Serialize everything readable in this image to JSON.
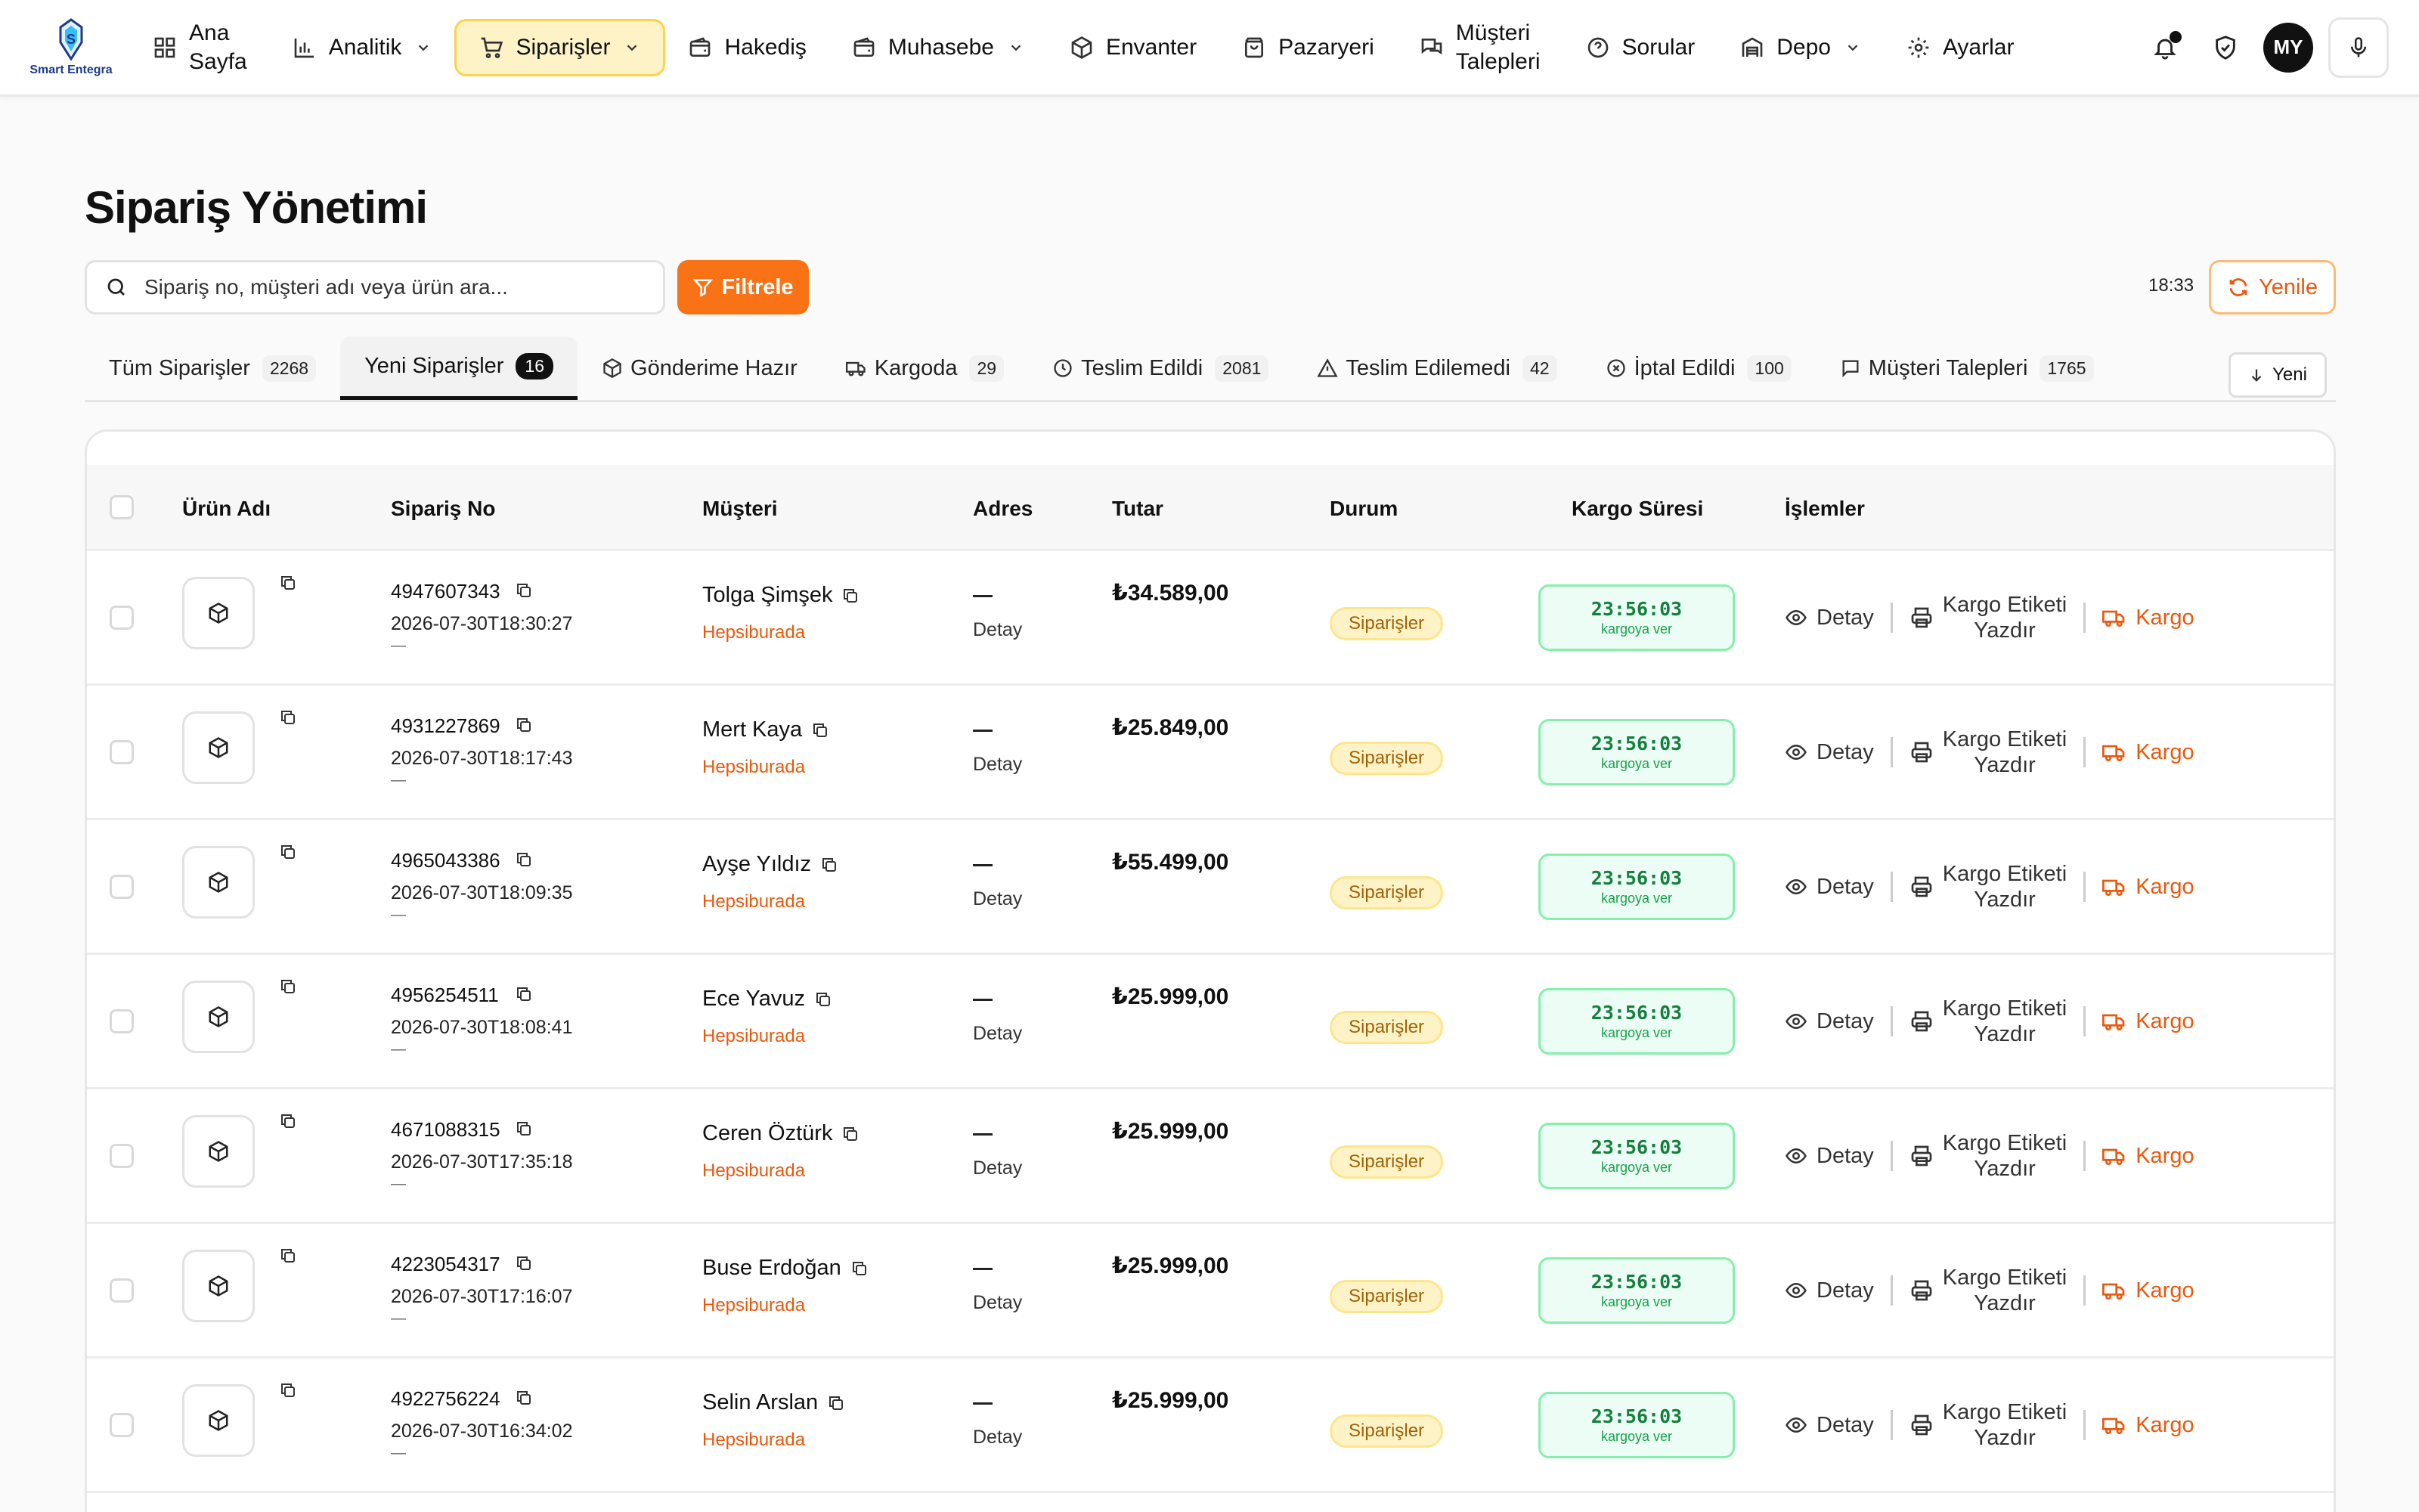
{
  "brand": {
    "logo_text": "Smart Entegra"
  },
  "nav": {
    "items": [
      {
        "label": "Ana Sayfa",
        "line1": "Ana",
        "line2": "Sayfa",
        "icon": "dashboard-icon"
      },
      {
        "label": "Analitik",
        "icon": "chart-icon",
        "dropdown": true
      },
      {
        "label": "Siparişler",
        "icon": "cart-icon",
        "dropdown": true,
        "active": true
      },
      {
        "label": "Hakediş",
        "icon": "wallet-icon"
      },
      {
        "label": "Muhasebe",
        "icon": "wallet-icon",
        "dropdown": true
      },
      {
        "label": "Envanter",
        "icon": "box-icon"
      },
      {
        "label": "Pazaryeri",
        "icon": "bag-icon"
      },
      {
        "label": "Müşteri Talepleri",
        "line1": "Müşteri",
        "line2": "Talepleri",
        "icon": "chat-icon"
      },
      {
        "label": "Sorular",
        "icon": "question-icon"
      },
      {
        "label": "Depo",
        "icon": "warehouse-icon",
        "dropdown": true
      },
      {
        "label": "Ayarlar",
        "icon": "gear-icon"
      }
    ],
    "user_initials": "MY"
  },
  "page": {
    "title": "Sipariş Yönetimi"
  },
  "toolbar": {
    "search_placeholder": "Sipariş no, müşteri adı veya ürün ara...",
    "filter_label": "Filtrele",
    "time": "18:33",
    "refresh_label": "Yenile",
    "sort_label": "Yeni"
  },
  "tabs": [
    {
      "label": "Tüm Siparişler",
      "count": "2268"
    },
    {
      "label": "Yeni Siparişler",
      "count": "16",
      "active": true
    },
    {
      "label": "Gönderime Hazır",
      "count": "",
      "icon": "box-icon"
    },
    {
      "label": "Kargoda",
      "count": "29",
      "icon": "truck-icon"
    },
    {
      "label": "Teslim Edildi",
      "count": "2081",
      "icon": "clock-icon"
    },
    {
      "label": "Teslim Edilemedi",
      "count": "42",
      "icon": "warning-icon"
    },
    {
      "label": "İptal Edildi",
      "count": "100",
      "icon": "x-circle-icon"
    },
    {
      "label": "Müşteri Talepleri",
      "count": "1765",
      "icon": "message-icon"
    }
  ],
  "table": {
    "headers": {
      "product": "Ürün Adı",
      "order_no": "Sipariş No",
      "customer": "Müşteri",
      "address": "Adres",
      "amount": "Tutar",
      "status": "Durum",
      "cargo_time": "Kargo Süresi",
      "actions": "İşlemler"
    },
    "rows": [
      {
        "order_no": "4947607343",
        "date": "2026-07-30T18:30:27",
        "customer": "Tolga Şimşek",
        "store": "Hepsiburada",
        "address_detail": "Detay",
        "amount": "₺34.589,00",
        "status": "Siparişler",
        "cargo_time": "23:56:03",
        "cargo_sub": "kargoya ver"
      },
      {
        "order_no": "4931227869",
        "date": "2026-07-30T18:17:43",
        "customer": "Mert Kaya",
        "store": "Hepsiburada",
        "address_detail": "Detay",
        "amount": "₺25.849,00",
        "status": "Siparişler",
        "cargo_time": "23:56:03",
        "cargo_sub": "kargoya ver"
      },
      {
        "order_no": "4965043386",
        "date": "2026-07-30T18:09:35",
        "customer": "Ayşe Yıldız",
        "store": "Hepsiburada",
        "address_detail": "Detay",
        "amount": "₺55.499,00",
        "status": "Siparişler",
        "cargo_time": "23:56:03",
        "cargo_sub": "kargoya ver"
      },
      {
        "order_no": "4956254511",
        "date": "2026-07-30T18:08:41",
        "customer": "Ece Yavuz",
        "store": "Hepsiburada",
        "address_detail": "Detay",
        "amount": "₺25.999,00",
        "status": "Siparişler",
        "cargo_time": "23:56:03",
        "cargo_sub": "kargoya ver"
      },
      {
        "order_no": "4671088315",
        "date": "2026-07-30T17:35:18",
        "customer": "Ceren Öztürk",
        "store": "Hepsiburada",
        "address_detail": "Detay",
        "amount": "₺25.999,00",
        "status": "Siparişler",
        "cargo_time": "23:56:03",
        "cargo_sub": "kargoya ver"
      },
      {
        "order_no": "4223054317",
        "date": "2026-07-30T17:16:07",
        "customer": "Buse Erdoğan",
        "store": "Hepsiburada",
        "address_detail": "Detay",
        "amount": "₺25.999,00",
        "status": "Siparişler",
        "cargo_time": "23:56:03",
        "cargo_sub": "kargoya ver"
      },
      {
        "order_no": "4922756224",
        "date": "2026-07-30T16:34:02",
        "customer": "Selin Arslan",
        "store": "Hepsiburada",
        "address_detail": "Detay",
        "amount": "₺25.999,00",
        "status": "Siparişler",
        "cargo_time": "23:56:03",
        "cargo_sub": "kargoya ver"
      }
    ],
    "actions": {
      "detail": "Detay",
      "label_line1": "Kargo Etiketi",
      "label_line2": "Yazdır",
      "cargo": "Kargo"
    }
  },
  "colors": {
    "accent": "#f97316",
    "active_nav_bg": "#fef3c7",
    "status_badge": "#fef3c7",
    "cargo_timer": "#ecfdf5"
  }
}
